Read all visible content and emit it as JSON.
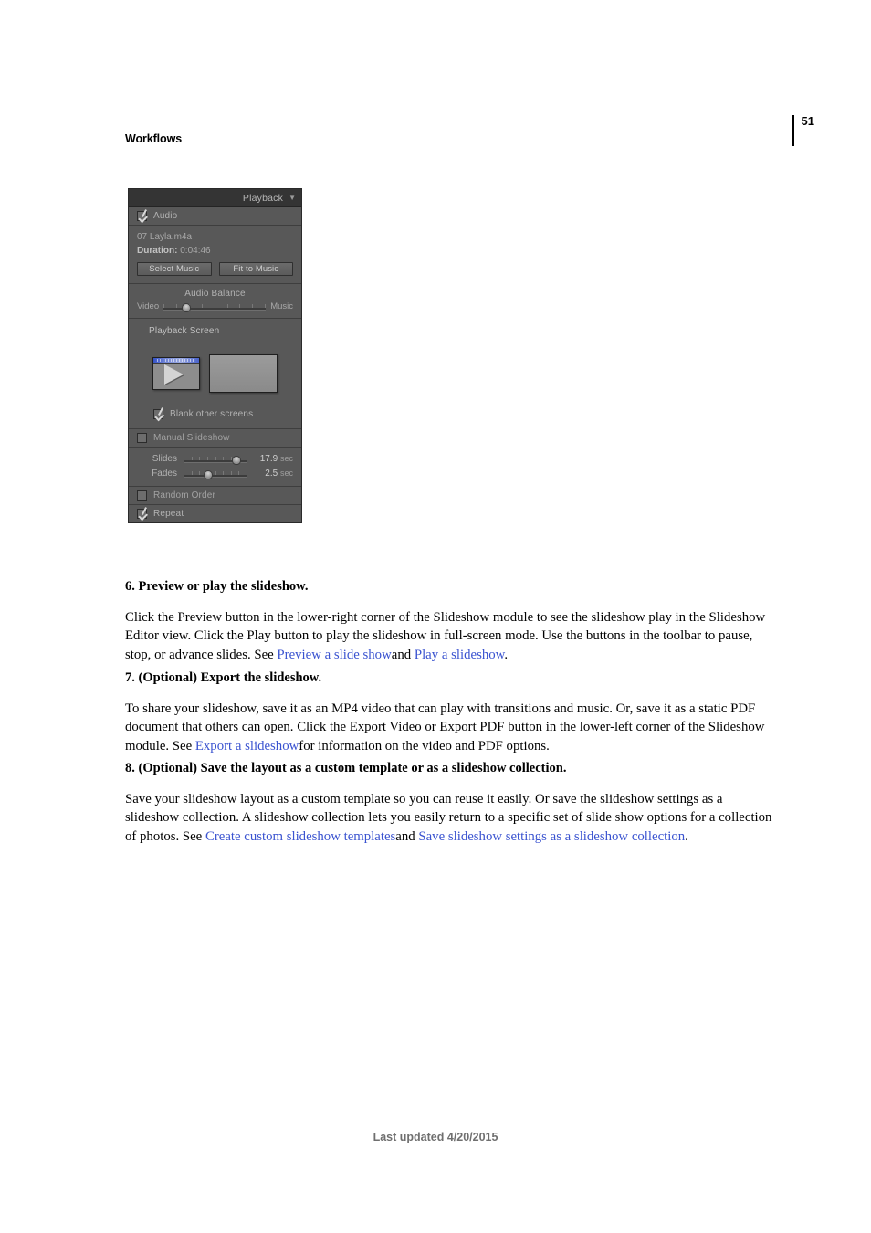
{
  "page": {
    "header_title": "Workflows",
    "page_number": "51",
    "footer": "Last updated 4/20/2015"
  },
  "panel": {
    "title": "Playback",
    "collapse_arrow": "▼",
    "audio": {
      "checkbox_label": "Audio",
      "checked": true,
      "track_name": "07 Layla.m4a",
      "duration_label": "Duration:",
      "duration_value": "0:04:46",
      "select_music_button": "Select Music",
      "fit_to_music_button": "Fit to Music"
    },
    "audio_balance": {
      "title": "Audio Balance",
      "left_label": "Video",
      "right_label": "Music",
      "value_percent": 22
    },
    "playback_screen": {
      "title": "Playback Screen",
      "screen_one_icon": "monitor-play-icon",
      "screen_two_icon": "monitor-blank-icon",
      "blank_other_screens_label": "Blank other screens",
      "blank_other_screens_checked": true
    },
    "manual_slideshow": {
      "label": "Manual Slideshow",
      "checked": false
    },
    "timing": {
      "slides_label": "Slides",
      "slides_value": "17.9",
      "slides_unit": "sec",
      "slides_percent": 83,
      "fades_label": "Fades",
      "fades_value": "2.5",
      "fades_unit": "sec",
      "fades_percent": 39
    },
    "random_order": {
      "label": "Random Order",
      "checked": false
    },
    "repeat": {
      "label": "Repeat",
      "checked": true
    }
  },
  "steps": [
    {
      "heading": "6. Preview or play the slideshow.",
      "body_1": "Click the Preview button in the lower-right corner of the Slideshow module to see the slideshow play in the Slideshow Editor view. Click the Play button to play the slideshow in full-screen mode. Use the buttons in the toolbar to pause, stop, or advance slides. See ",
      "link_1": "Preview a slide show",
      "body_2": "and ",
      "link_2": "Play a slideshow",
      "body_3": "."
    },
    {
      "heading": "7. (Optional) Export the slideshow.",
      "body_1": "To share your slideshow, save it as an MP4 video that can play with transitions and music. Or, save it as a static PDF document that others can open. Click the Export Video or Export PDF button in the lower-left corner of the Slideshow module. See ",
      "link_1": "Export a slideshow",
      "body_2": "for information on the video and PDF options."
    },
    {
      "heading": "8. (Optional) Save the layout as a custom template or as a slideshow collection.",
      "body_1": "Save your slideshow layout as a custom template so you can reuse it easily. Or save the slideshow settings as a slideshow collection. A slideshow collection lets you easily return to a specific set of slide show options for a collection of photos. See ",
      "link_1": "Create custom slideshow templates",
      "body_2": "and ",
      "link_2": "Save slideshow settings as a slideshow collection",
      "body_3": "."
    }
  ],
  "colors": {
    "link": "#3a53d0",
    "panel_body": "#585858",
    "panel_header": "#343434",
    "footer_text": "#6f6f6f"
  }
}
